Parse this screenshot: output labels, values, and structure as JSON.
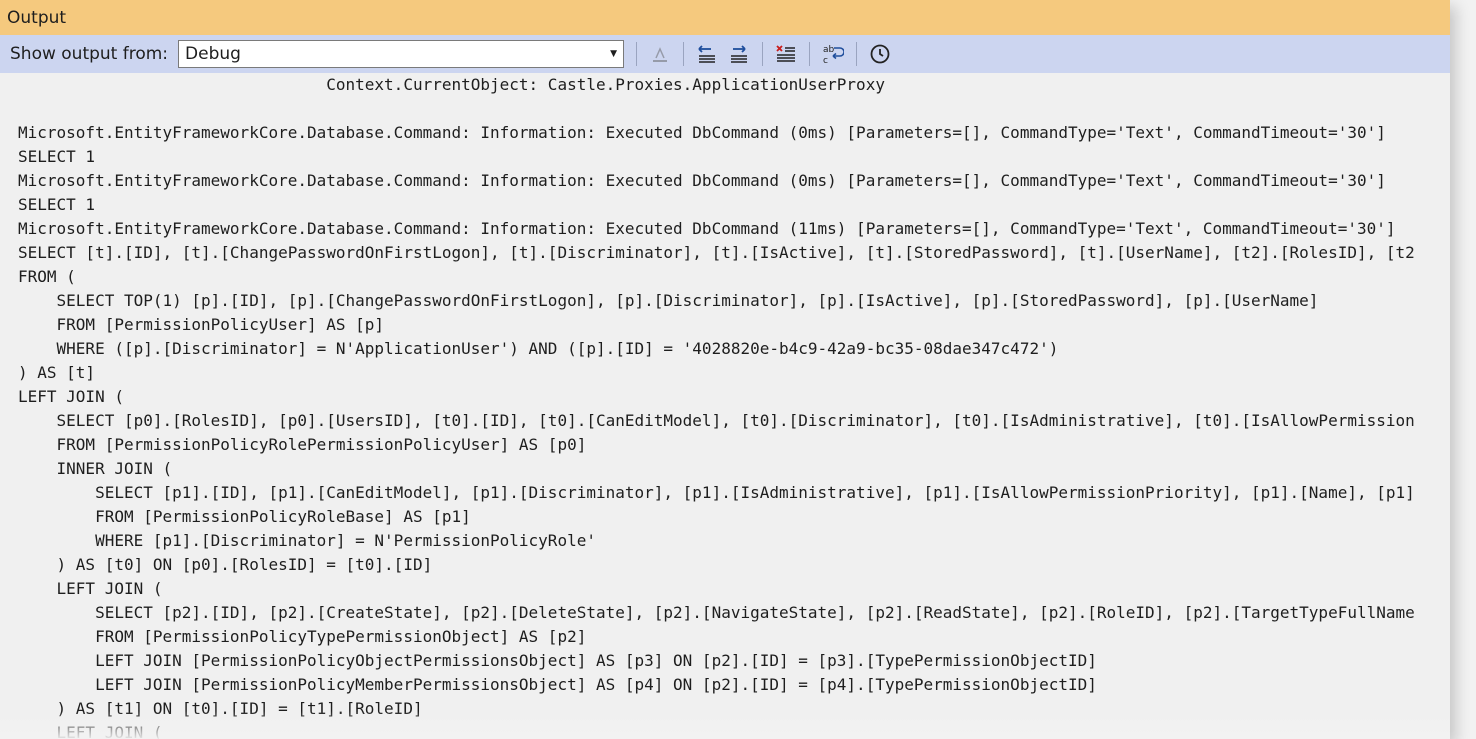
{
  "window": {
    "title": "Output"
  },
  "toolbar": {
    "show_output_label": "Show output from:",
    "source_selected": "Debug",
    "buttons": [
      {
        "icon": "find-message-icon",
        "enabled": false
      },
      {
        "icon": "previous-message-icon",
        "enabled": true
      },
      {
        "icon": "next-message-icon",
        "enabled": true
      },
      {
        "icon": "clear-all-icon",
        "enabled": true
      },
      {
        "icon": "word-wrap-icon",
        "enabled": true
      },
      {
        "icon": "timestamp-icon",
        "enabled": true
      }
    ]
  },
  "output": {
    "lines": [
      "                                Context.CurrentObject: Castle.Proxies.ApplicationUserProxy",
      "",
      "Microsoft.EntityFrameworkCore.Database.Command: Information: Executed DbCommand (0ms) [Parameters=[], CommandType='Text', CommandTimeout='30']",
      "SELECT 1",
      "Microsoft.EntityFrameworkCore.Database.Command: Information: Executed DbCommand (0ms) [Parameters=[], CommandType='Text', CommandTimeout='30']",
      "SELECT 1",
      "Microsoft.EntityFrameworkCore.Database.Command: Information: Executed DbCommand (11ms) [Parameters=[], CommandType='Text', CommandTimeout='30']",
      "SELECT [t].[ID], [t].[ChangePasswordOnFirstLogon], [t].[Discriminator], [t].[IsActive], [t].[StoredPassword], [t].[UserName], [t2].[RolesID], [t2",
      "FROM (",
      "    SELECT TOP(1) [p].[ID], [p].[ChangePasswordOnFirstLogon], [p].[Discriminator], [p].[IsActive], [p].[StoredPassword], [p].[UserName]",
      "    FROM [PermissionPolicyUser] AS [p]",
      "    WHERE ([p].[Discriminator] = N'ApplicationUser') AND ([p].[ID] = '4028820e-b4c9-42a9-bc35-08dae347c472')",
      ") AS [t]",
      "LEFT JOIN (",
      "    SELECT [p0].[RolesID], [p0].[UsersID], [t0].[ID], [t0].[CanEditModel], [t0].[Discriminator], [t0].[IsAdministrative], [t0].[IsAllowPermission",
      "    FROM [PermissionPolicyRolePermissionPolicyUser] AS [p0]",
      "    INNER JOIN (",
      "        SELECT [p1].[ID], [p1].[CanEditModel], [p1].[Discriminator], [p1].[IsAdministrative], [p1].[IsAllowPermissionPriority], [p1].[Name], [p1]",
      "        FROM [PermissionPolicyRoleBase] AS [p1]",
      "        WHERE [p1].[Discriminator] = N'PermissionPolicyRole'",
      "    ) AS [t0] ON [p0].[RolesID] = [t0].[ID]",
      "    LEFT JOIN (",
      "        SELECT [p2].[ID], [p2].[CreateState], [p2].[DeleteState], [p2].[NavigateState], [p2].[ReadState], [p2].[RoleID], [p2].[TargetTypeFullName",
      "        FROM [PermissionPolicyTypePermissionObject] AS [p2]",
      "        LEFT JOIN [PermissionPolicyObjectPermissionsObject] AS [p3] ON [p2].[ID] = [p3].[TypePermissionObjectID]",
      "        LEFT JOIN [PermissionPolicyMemberPermissionsObject] AS [p4] ON [p2].[ID] = [p4].[TypePermissionObjectID]",
      "    ) AS [t1] ON [t0].[ID] = [t1].[RoleID]",
      "    LEFT JOIN ("
    ]
  }
}
